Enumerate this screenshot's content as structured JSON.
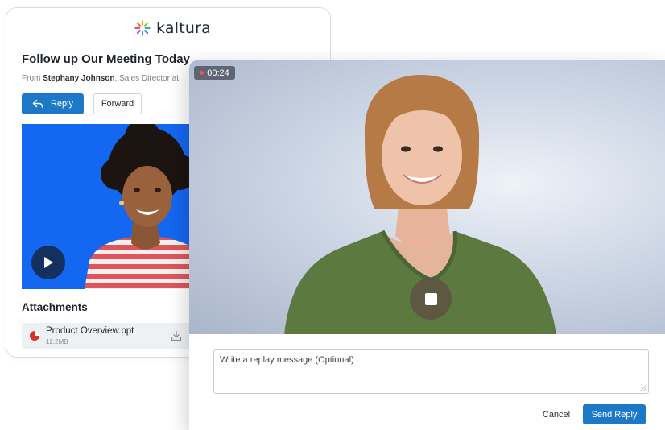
{
  "brand": {
    "name": "kaltura"
  },
  "email": {
    "title": "Follow up Our Meeting Today",
    "from_prefix": "From",
    "sender_name": "Stephany Johnson",
    "sender_role": ", Sales Director at",
    "reply_label": "Reply",
    "forward_label": "Forward",
    "attachments_title": "Attachments",
    "attachment": {
      "name": "Product Overview.ppt",
      "size": "12.2MB"
    }
  },
  "recorder": {
    "timer": "00:24",
    "message_placeholder": "Write a replay message (Optional)",
    "cancel_label": "Cancel",
    "send_label": "Send Reply"
  },
  "colors": {
    "accent": "#1d78c7",
    "email_video_bg": "#1467f0",
    "play_button": "#13305f",
    "recording_dot": "#ff4d4f",
    "attachment_icon": "#d8322a"
  },
  "icons": {
    "logo": "kaltura-sparkle-icon",
    "reply": "reply-arrow-icon",
    "play": "play-icon",
    "attachment": "ppt-file-icon",
    "download": "download-icon",
    "stop": "stop-icon"
  }
}
